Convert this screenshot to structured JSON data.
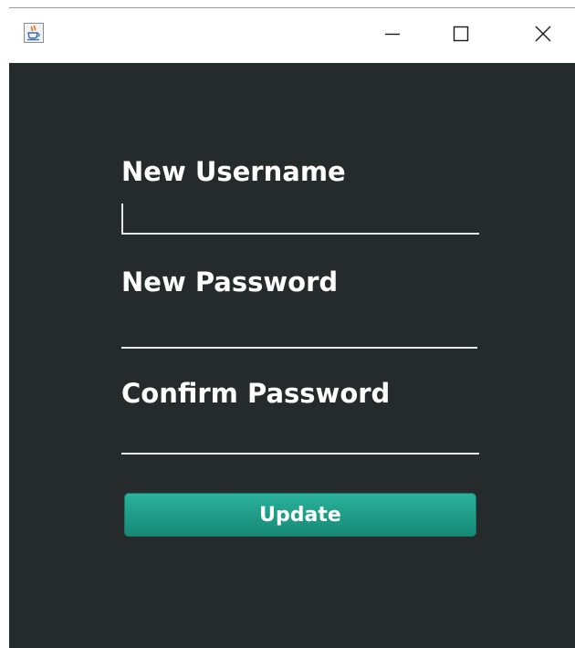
{
  "window": {
    "title": "",
    "icons": {
      "app": "java-coffee-cup-icon",
      "minimize": "minimize-icon",
      "maximize": "maximize-icon",
      "close": "close-icon"
    },
    "colors": {
      "titlebar": "#ffffff",
      "content_background": "#252a2b"
    }
  },
  "form": {
    "fields": [
      {
        "label": "New Username",
        "value": "",
        "placeholder": ""
      },
      {
        "label": "New Password",
        "value": "",
        "placeholder": ""
      },
      {
        "label": "Confirm Password",
        "value": "",
        "placeholder": ""
      }
    ],
    "submit_label": "Update",
    "colors": {
      "label": "#ffffff",
      "underline": "#e8e8e8",
      "button": "#1f9d88",
      "button_text": "#ffffff"
    }
  }
}
